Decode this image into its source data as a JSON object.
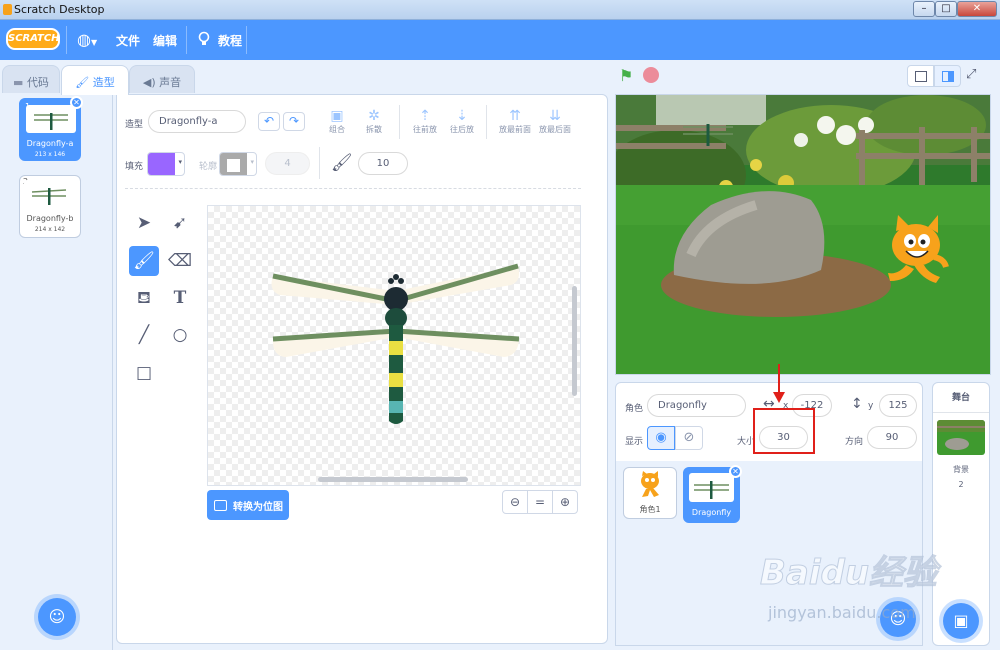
{
  "window": {
    "title": "Scratch Desktop",
    "btn_min": "–",
    "btn_max": "□",
    "btn_close": "✕"
  },
  "menu": {
    "logo": "SCRATCH",
    "globe": "◍",
    "file": "文件",
    "edit": "编辑",
    "tutorials": "教程"
  },
  "tabs": {
    "code": "代码",
    "costumes": "造型",
    "sounds": "声音"
  },
  "costumes": [
    {
      "num": "1",
      "name": "Dragonfly-a",
      "size": "213 x 146"
    },
    {
      "num": "2",
      "name": "Dragonfly-b",
      "size": "214 x 142"
    }
  ],
  "editor": {
    "costume_label": "造型",
    "costume_name": "Dragonfly-a",
    "tools_top": [
      "组合",
      "拆散",
      "往前放",
      "往后放",
      "放最前面",
      "放最后面"
    ],
    "fill_label": "填充",
    "outline_label": "轮廓",
    "outline_width": "4",
    "brush_size": "10",
    "convert_button": "转换为位图",
    "zoom_out": "⊖",
    "zoom_reset": "=",
    "zoom_in": "⊕",
    "fill_color": "#9966ff"
  },
  "stage": {
    "flag": "⚑",
    "stop": "●"
  },
  "sprite_info": {
    "sprite_label": "角色",
    "sprite_name": "Dragonfly",
    "x_label": "x",
    "x_value": "-122",
    "y_label": "y",
    "y_value": "125",
    "show_label": "显示",
    "size_label": "大小",
    "size_value": "30",
    "direction_label": "方向",
    "direction_value": "90"
  },
  "sprites": [
    {
      "name": "角色1"
    },
    {
      "name": "Dragonfly"
    }
  ],
  "stage_pane": {
    "title": "舞台",
    "backdrops_label": "背景",
    "backdrops_count": "2"
  },
  "watermark": {
    "main": "Baidu经验",
    "sub": "jingyan.baidu.com"
  },
  "colors": {
    "accent": "#4c97ff",
    "highlight_box": "#e0201a"
  }
}
